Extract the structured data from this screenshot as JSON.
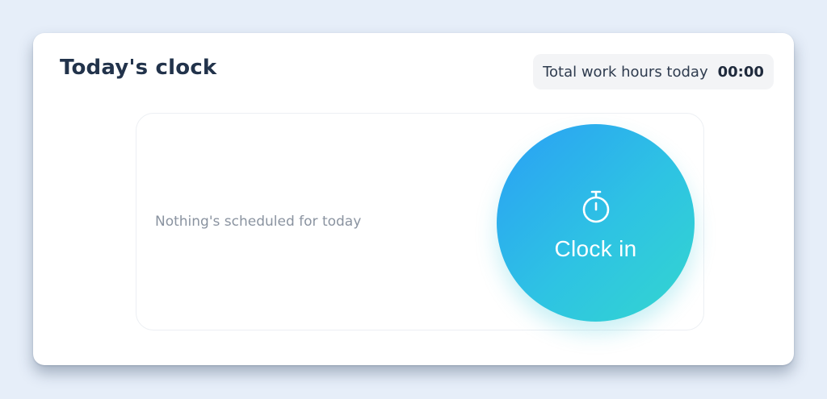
{
  "card": {
    "title": "Today's clock",
    "total_hours_label": "Total work hours today",
    "total_hours_value": "00:00"
  },
  "schedule": {
    "empty_message": "Nothing's scheduled for today"
  },
  "clock_button": {
    "label": "Clock in",
    "icon": "stopwatch-icon"
  },
  "colors": {
    "page_background": "#e6eef9",
    "card_background": "#ffffff",
    "title_text": "#22334b",
    "gradient_start": "#2a9ff5",
    "gradient_end": "#33d6cf",
    "muted_text": "#8a93a0"
  }
}
